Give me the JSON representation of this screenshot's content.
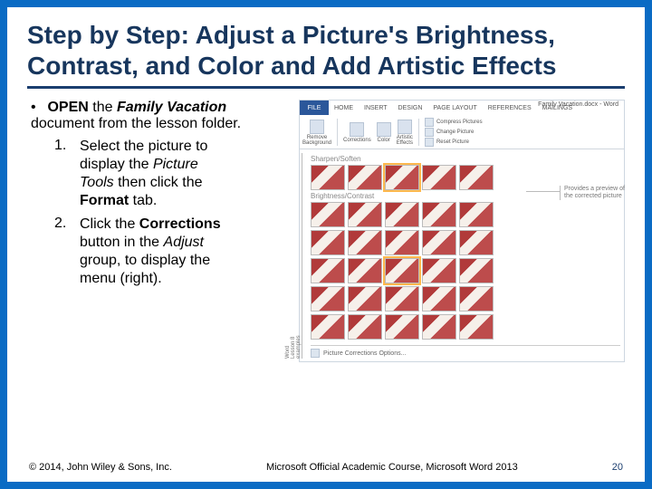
{
  "title": "Step by Step: Adjust a Picture's Brightness, Contrast, and Color and Add Artistic Effects",
  "open_line": {
    "bullet": "•",
    "p1": "OPEN",
    "p2": " the ",
    "p3": "Family Vacation",
    "p4": " document from the lesson folder."
  },
  "steps": [
    {
      "num": "1.",
      "segments": {
        "a": "Select the picture to display the ",
        "b": "Picture Tools",
        "c": " then click the ",
        "d": "Format",
        "e": " tab."
      }
    },
    {
      "num": "2.",
      "segments": {
        "a": "Click the ",
        "b": "Corrections",
        "c": " button in the ",
        "d": "Adjust",
        "e": " group, to display the menu (right)."
      }
    }
  ],
  "figure": {
    "titlebar": "Family Vacation.docx - Word",
    "tabs": {
      "file": "FILE",
      "home": "HOME",
      "insert": "INSERT",
      "design": "DESIGN",
      "pagelayout": "PAGE LAYOUT",
      "references": "REFERENCES",
      "mailings": "MAILINGS"
    },
    "ribbon": {
      "remove_bg": "Remove\nBackground",
      "corrections": "Corrections",
      "color": "Color",
      "artistic": "Artistic\nEffects",
      "compress": "Compress Pictures",
      "change": "Change Picture",
      "reset": "Reset Picture"
    },
    "gallery": {
      "left_label": "Word Lesson 8 examples",
      "section1": "Sharpen/Soften",
      "section2": "Brightness/Contrast",
      "footer_icon_label": "Picture Corrections Options..."
    },
    "callout": "Provides a preview of the corrected picture"
  },
  "footer": {
    "left": "© 2014, John Wiley & Sons, Inc.",
    "center": "Microsoft Official Academic Course, Microsoft Word 2013",
    "right": "20"
  }
}
